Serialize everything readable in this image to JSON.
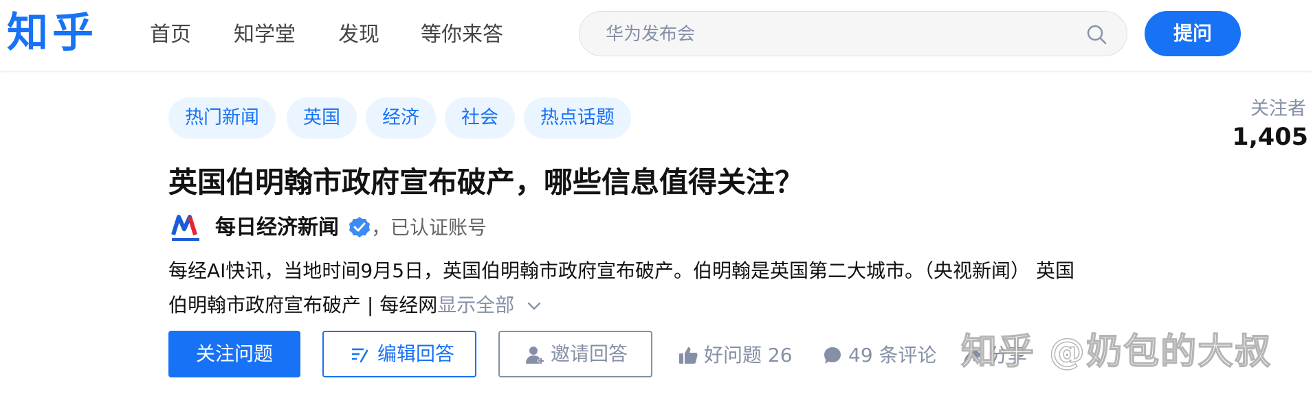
{
  "app": {
    "logo_text": "知乎",
    "brand_color": "#1772f6"
  },
  "nav": {
    "items": [
      {
        "label": "首页"
      },
      {
        "label": "知学堂"
      },
      {
        "label": "发现"
      },
      {
        "label": "等你来答"
      }
    ]
  },
  "search": {
    "placeholder": "华为发布会",
    "value": "",
    "icon": "search-icon"
  },
  "header": {
    "ask_label": "提问"
  },
  "question": {
    "tags": [
      {
        "label": "热门新闻"
      },
      {
        "label": "英国"
      },
      {
        "label": "经济"
      },
      {
        "label": "社会"
      },
      {
        "label": "热点话题"
      }
    ],
    "title": "英国伯明翰市政府宣布破产，哪些信息值得关注？",
    "author": {
      "name": "每日经济新闻",
      "verified_text": "，已认证账号",
      "avatar_icon": "nbd-logo-icon"
    },
    "excerpt": "每经AI快讯，当地时间9月5日，英国伯明翰市政府宣布破产。伯明翰是英国第二大城市。（央视新闻） 英国伯明翰市政府宣布破产 | 每经网",
    "show_all_label": "显示全部",
    "followers_label": "关注者",
    "followers_count": "1,405"
  },
  "actions": {
    "follow_label": "关注问题",
    "write_label": "编辑回答",
    "invite_label": "邀请回答",
    "good_question_label": "好问题 26",
    "comments_label": "49 条评论",
    "share_label": "分享"
  },
  "watermark": {
    "text": "知乎 @奶包的大叔"
  }
}
